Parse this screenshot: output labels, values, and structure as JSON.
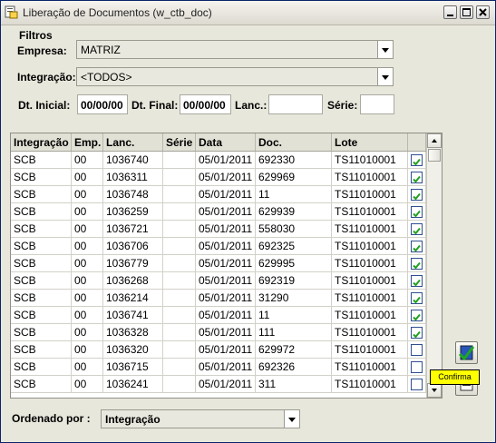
{
  "window": {
    "title": "Liberação de Documentos (w_ctb_doc)",
    "controls": [
      "minimize-icon",
      "maximize-icon",
      "close-icon"
    ]
  },
  "filters": {
    "group_label": "Filtros",
    "empresa_label": "Empresa:",
    "empresa_value": "MATRIZ",
    "integracao_label": "Integração:",
    "integracao_value": "<TODOS>",
    "dt_inicial_label": "Dt. Inicial:",
    "dt_inicial_value": "00/00/00",
    "dt_final_label": "Dt. Final:",
    "dt_final_value": "00/00/00",
    "lanc_label": "Lanc.:",
    "lanc_value": "",
    "serie_label": "Série:",
    "serie_value": ""
  },
  "table": {
    "columns": [
      "Integração",
      "Emp.",
      "Lanc.",
      "Série",
      "Data",
      "Doc.",
      "Lote"
    ],
    "rows": [
      {
        "integracao": "SCB",
        "emp": "00",
        "lanc": "1036740",
        "serie": "",
        "data": "05/01/2011",
        "doc": "692330",
        "lote": "TS11010001",
        "checked": true
      },
      {
        "integracao": "SCB",
        "emp": "00",
        "lanc": "1036311",
        "serie": "",
        "data": "05/01/2011",
        "doc": "629969",
        "lote": "TS11010001",
        "checked": true
      },
      {
        "integracao": "SCB",
        "emp": "00",
        "lanc": "1036748",
        "serie": "",
        "data": "05/01/2011",
        "doc": "11",
        "lote": "TS11010001",
        "checked": true
      },
      {
        "integracao": "SCB",
        "emp": "00",
        "lanc": "1036259",
        "serie": "",
        "data": "05/01/2011",
        "doc": "629939",
        "lote": "TS11010001",
        "checked": true
      },
      {
        "integracao": "SCB",
        "emp": "00",
        "lanc": "1036721",
        "serie": "",
        "data": "05/01/2011",
        "doc": "558030",
        "lote": "TS11010001",
        "checked": true
      },
      {
        "integracao": "SCB",
        "emp": "00",
        "lanc": "1036706",
        "serie": "",
        "data": "05/01/2011",
        "doc": "692325",
        "lote": "TS11010001",
        "checked": true
      },
      {
        "integracao": "SCB",
        "emp": "00",
        "lanc": "1036779",
        "serie": "",
        "data": "05/01/2011",
        "doc": "629995",
        "lote": "TS11010001",
        "checked": true
      },
      {
        "integracao": "SCB",
        "emp": "00",
        "lanc": "1036268",
        "serie": "",
        "data": "05/01/2011",
        "doc": "692319",
        "lote": "TS11010001",
        "checked": true
      },
      {
        "integracao": "SCB",
        "emp": "00",
        "lanc": "1036214",
        "serie": "",
        "data": "05/01/2011",
        "doc": "31290",
        "lote": "TS11010001",
        "checked": true
      },
      {
        "integracao": "SCB",
        "emp": "00",
        "lanc": "1036741",
        "serie": "",
        "data": "05/01/2011",
        "doc": "11",
        "lote": "TS11010001",
        "checked": true
      },
      {
        "integracao": "SCB",
        "emp": "00",
        "lanc": "1036328",
        "serie": "",
        "data": "05/01/2011",
        "doc": "111",
        "lote": "TS11010001",
        "checked": true
      },
      {
        "integracao": "SCB",
        "emp": "00",
        "lanc": "1036320",
        "serie": "",
        "data": "05/01/2011",
        "doc": "629972",
        "lote": "TS11010001",
        "checked": false
      },
      {
        "integracao": "SCB",
        "emp": "00",
        "lanc": "1036715",
        "serie": "",
        "data": "05/01/2011",
        "doc": "692326",
        "lote": "TS11010001",
        "checked": false
      },
      {
        "integracao": "SCB",
        "emp": "00",
        "lanc": "1036241",
        "serie": "",
        "data": "05/01/2011",
        "doc": "311",
        "lote": "TS11010001",
        "checked": false
      }
    ]
  },
  "actions": {
    "confirm_icon": "confirm-icon",
    "tooltip": "Confirma",
    "second_icon": "document-icon"
  },
  "footer": {
    "order_label": "Ordenado por :",
    "order_value": "Integração"
  },
  "colors": {
    "check_green": "#21a121",
    "tooltip_bg": "#ffff00",
    "window_bg": "#e8e7dc"
  }
}
